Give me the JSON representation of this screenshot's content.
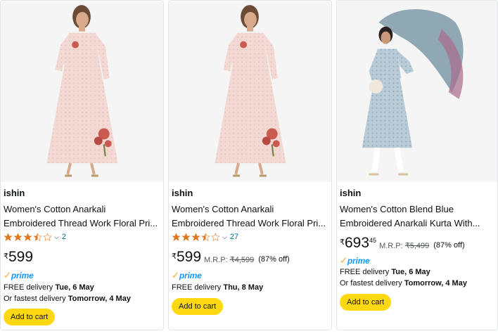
{
  "products": [
    {
      "brand": "ishin",
      "title_line1": "Women's Cotton Anarkali",
      "title_line2": "Embroidered Thread Work Floral Pri...",
      "rating_stars": 3.5,
      "rating_count": "2",
      "price_symbol": "₹",
      "price_whole": "599",
      "prime_label": "prime",
      "delivery_prefix": "FREE delivery ",
      "delivery_date": "Tue, 6 May",
      "fastest_prefix": "Or fastest delivery ",
      "fastest_date": "Tomorrow, 4 May",
      "cart_label": "Add to cart"
    },
    {
      "brand": "ishin",
      "title_line1": "Women's Cotton Anarkali",
      "title_line2": "Embroidered Thread Work Floral Pri...",
      "rating_stars": 3.5,
      "rating_count": "27",
      "price_symbol": "₹",
      "price_whole": "599",
      "mrp_label": "M.R.P: ",
      "mrp_value": "₹4,599",
      "discount": "(87% off)",
      "prime_label": "prime",
      "delivery_prefix": "FREE delivery ",
      "delivery_date": "Thu, 8 May",
      "cart_label": "Add to cart"
    },
    {
      "brand": "ishin",
      "title_line1": "Women's Cotton Blend Blue",
      "title_line2": "Embroidered Anarkali Kurta With...",
      "price_symbol": "₹",
      "price_whole": "693",
      "price_fraction": "45",
      "mrp_label": "M.R.P: ",
      "mrp_value": "₹5,499",
      "discount": "(87% off)",
      "prime_label": "prime",
      "delivery_prefix": "FREE delivery ",
      "delivery_date": "Tue, 6 May",
      "fastest_prefix": "Or fastest delivery ",
      "fastest_date": "Tomorrow, 4 May",
      "cart_label": "Add to cart"
    }
  ],
  "colors": {
    "add_to_cart": "#ffd814",
    "star": "#de7921",
    "link": "#007185",
    "prime_check": "#febd69",
    "prime_word": "#1399ff"
  }
}
